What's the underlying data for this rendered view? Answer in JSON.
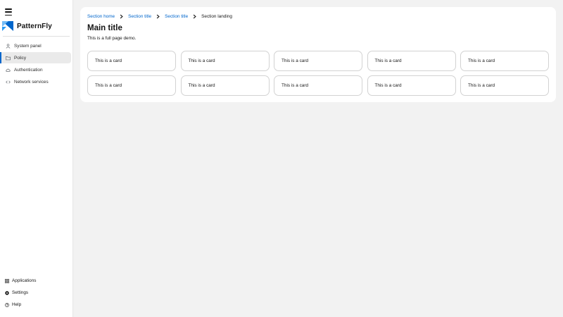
{
  "app": {
    "brand": "PatternFly",
    "brand_color": "#0066cc"
  },
  "sidebar": {
    "items": [
      {
        "label": "System panel",
        "icon": "user-icon"
      },
      {
        "label": "Policy",
        "icon": "folder-icon",
        "active": true
      },
      {
        "label": "Authentication",
        "icon": "cloud-icon"
      },
      {
        "label": "Network services",
        "icon": "code-icon"
      }
    ],
    "bottom_items": [
      {
        "label": "Applications",
        "icon": "grid-icon"
      },
      {
        "label": "Settings",
        "icon": "gear-icon"
      },
      {
        "label": "Help",
        "icon": "help-icon"
      }
    ]
  },
  "breadcrumb": {
    "items": [
      "Section home",
      "Section title",
      "Section title"
    ],
    "current": "Section landing"
  },
  "main": {
    "title": "Main title",
    "description": "This is a full page demo.",
    "cards": [
      "This is a card",
      "This is a card",
      "This is a card",
      "This is a card",
      "This is a card",
      "This is a card",
      "This is a card",
      "This is a card",
      "This is a card",
      "This is a card"
    ]
  }
}
